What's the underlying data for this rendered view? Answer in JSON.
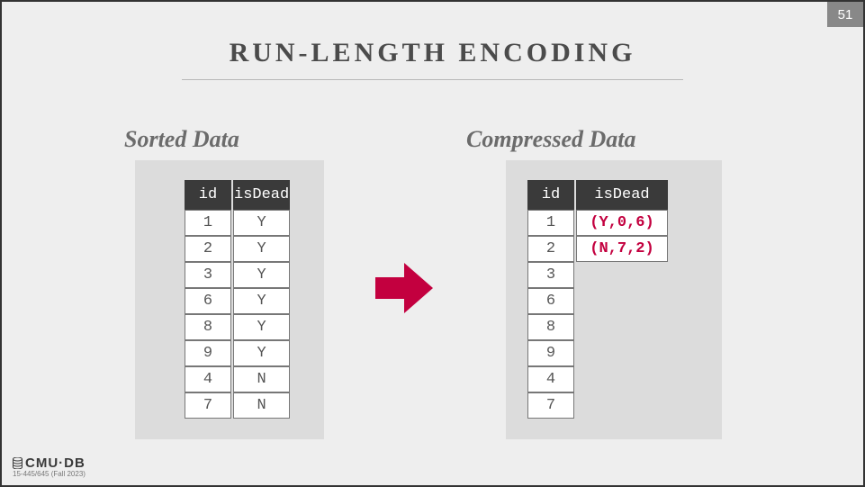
{
  "page_number": "51",
  "title": "RUN-LENGTH ENCODING",
  "left_label": "Sorted Data",
  "right_label": "Compressed Data",
  "headers": {
    "id": "id",
    "isDead": "isDead"
  },
  "sorted": {
    "id": [
      "1",
      "2",
      "3",
      "6",
      "8",
      "9",
      "4",
      "7"
    ],
    "isDead": [
      "Y",
      "Y",
      "Y",
      "Y",
      "Y",
      "Y",
      "N",
      "N"
    ]
  },
  "compressed": {
    "id": [
      "1",
      "2",
      "3",
      "6",
      "8",
      "9",
      "4",
      "7"
    ],
    "isDead": [
      "(Y,0,6)",
      "(N,7,2)"
    ]
  },
  "footer": {
    "logo": "CMU·DB",
    "sub": "15-445/645 (Fall 2023)"
  }
}
